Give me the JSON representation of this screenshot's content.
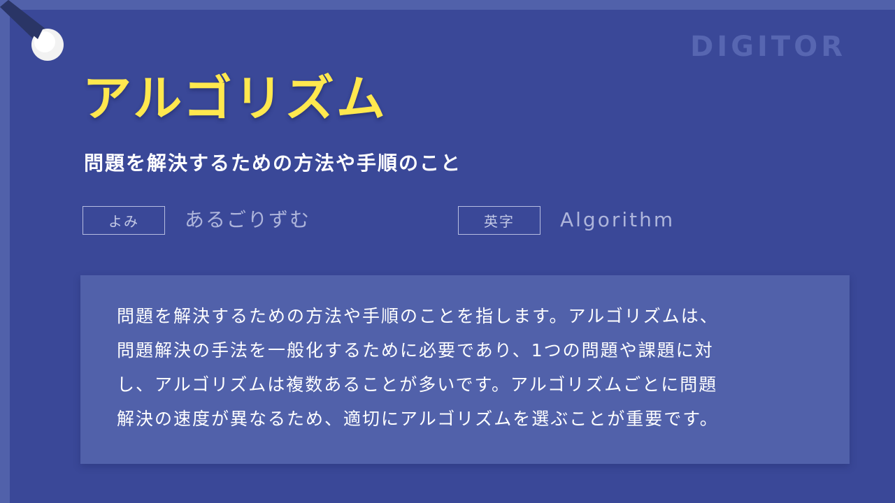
{
  "brand": "DIGITOR",
  "term": {
    "title": "アルゴリズム",
    "subtitle": "問題を解決するための方法や手順のこと"
  },
  "reading": {
    "label": "よみ",
    "value": "あるごりずむ"
  },
  "english": {
    "label": "英字",
    "value": "Algorithm"
  },
  "description": {
    "lines": [
      "問題を解決するための方法や手順のことを指します。アルゴリズムは、",
      "問題解決の手法を一般化するために必要であり、1つの問題や課題に対",
      "し、アルゴリズムは複数あることが多いです。アルゴリズムごとに問題",
      "解決の速度が異なるため、適切にアルゴリズムを選ぶことが重要です。"
    ]
  },
  "colors": {
    "background": "#3a4898",
    "frame": "#5161aa",
    "title": "#ffe84e",
    "brand": "#5766b1",
    "pin": "#f2f2f2",
    "strap": "#2a3566"
  },
  "icons": {
    "pin": "pushpin-icon"
  }
}
